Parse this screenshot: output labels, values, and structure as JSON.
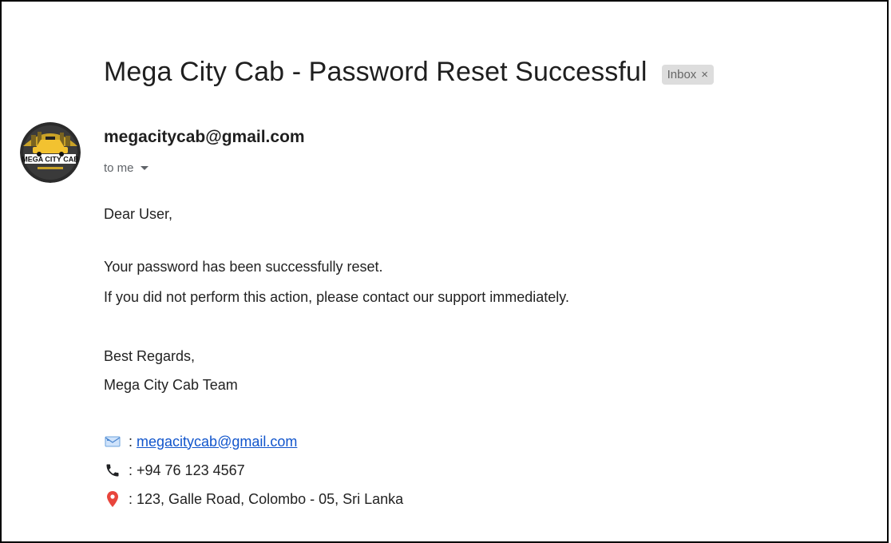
{
  "email": {
    "subject": "Mega City Cab - Password Reset Successful",
    "label": "Inbox",
    "label_close": "×",
    "sender": "megacitycab@gmail.com",
    "recipient": "to me",
    "avatar_text": "MEGA CITY CAB"
  },
  "body": {
    "greeting": "Dear User,",
    "line1": "Your password has been successfully reset.",
    "line2": "If you did not perform this action, please contact our support immediately.",
    "closing": "Best Regards,",
    "signature": "Mega City Cab Team"
  },
  "contact": {
    "email_sep": " : ",
    "email": "megacitycab@gmail.com",
    "phone": " : +94 76 123 4567",
    "address": " : 123, Galle Road, Colombo - 05, Sri Lanka"
  },
  "icons": {
    "email": "envelope-icon",
    "phone": "phone-icon",
    "address": "location-pin-icon"
  },
  "colors": {
    "link": "#1155cc",
    "label_bg": "#dddddd",
    "phone_icon": "#202124",
    "pin_icon": "#ea4335",
    "envelope_icon": "#8ab4f8"
  }
}
